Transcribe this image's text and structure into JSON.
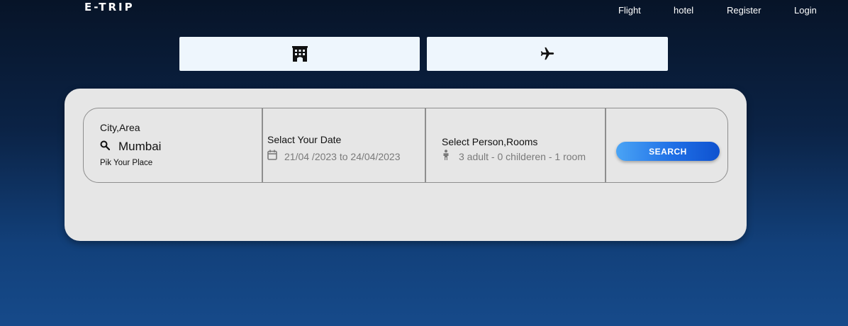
{
  "brand": {
    "name": "E-TRIP"
  },
  "nav": {
    "items": [
      {
        "label": "Flight"
      },
      {
        "label": "hotel"
      },
      {
        "label": "Register"
      },
      {
        "label": "Login"
      }
    ]
  },
  "tabs": [
    {
      "icon": "hotel-icon"
    },
    {
      "icon": "airplane-icon"
    }
  ],
  "search": {
    "location": {
      "label": "City,Area",
      "value": "Mumbai",
      "hint": "Pik Your Place",
      "icon": "search-icon"
    },
    "date": {
      "label": "Selact Your Date",
      "value": "21/04 /2023 to 24/04/2023",
      "icon": "calendar-icon"
    },
    "guests": {
      "label": "Select Person,Rooms",
      "value": "3 adult - 0 childeren - 1 room",
      "icon": "person-icon"
    },
    "button_label": "SEARCH"
  },
  "colors": {
    "background_top": "#071428",
    "background_bottom": "#164a8a",
    "card": "#e6e6e6",
    "tab": "#eef6fd",
    "button_start": "#4aa4f5",
    "button_end": "#0f52cf"
  }
}
